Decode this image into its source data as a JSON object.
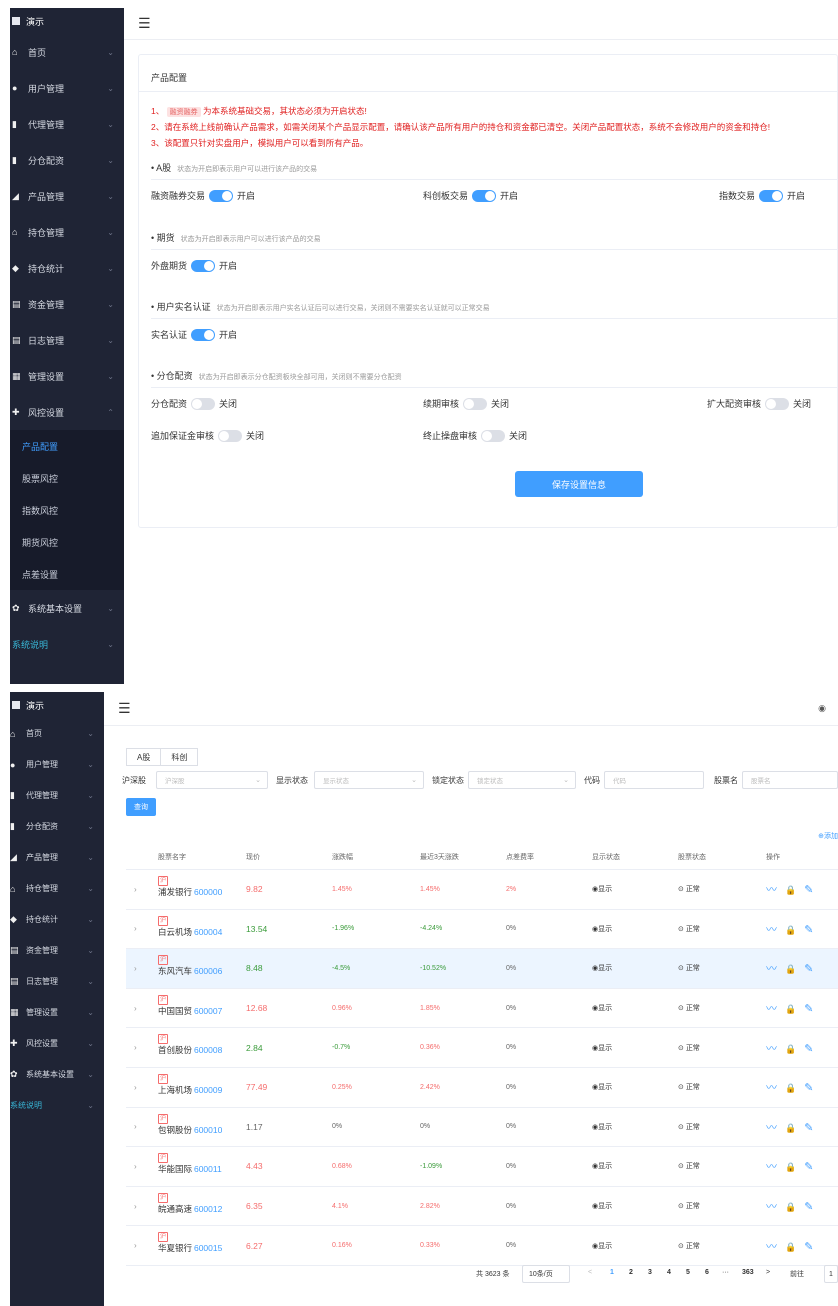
{
  "screen1": {
    "logo": "演示",
    "nav": [
      {
        "icon": "home-icon",
        "glyph": "⌂",
        "label": "首页",
        "chev": false
      },
      {
        "icon": "user-icon",
        "glyph": "●",
        "label": "用户管理",
        "chev": true
      },
      {
        "icon": "agent-icon",
        "glyph": "▮",
        "label": "代理管理",
        "chev": true
      },
      {
        "icon": "allocation-icon",
        "glyph": "▮",
        "label": "分仓配资",
        "chev": true
      },
      {
        "icon": "product-icon",
        "glyph": "◢",
        "label": "产品管理",
        "chev": true
      },
      {
        "icon": "position-icon",
        "glyph": "⌂",
        "label": "持仓管理",
        "chev": true
      },
      {
        "icon": "stats-icon",
        "glyph": "◆",
        "label": "持仓统计",
        "chev": true
      },
      {
        "icon": "fund-icon",
        "glyph": "▤",
        "label": "资金管理",
        "chev": true
      },
      {
        "icon": "log-icon",
        "glyph": "▤",
        "label": "日志管理",
        "chev": true
      },
      {
        "icon": "admin-icon",
        "glyph": "▦",
        "label": "管理设置",
        "chev": true
      },
      {
        "icon": "risk-icon",
        "glyph": "✚",
        "label": "风控设置",
        "chev": true,
        "open": true
      }
    ],
    "sub_nav": [
      {
        "label": "产品配置",
        "active": true
      },
      {
        "label": "股票风控",
        "active": false
      },
      {
        "label": "指数风控",
        "active": false
      },
      {
        "label": "期货风控",
        "active": false
      },
      {
        "label": "点差设置",
        "active": false
      }
    ],
    "nav_after": [
      {
        "icon": "system-icon",
        "glyph": "✿",
        "label": "系统基本设置",
        "chev": true
      },
      {
        "icon": "",
        "glyph": "",
        "label": "系统说明",
        "chev": true,
        "cyan": true
      }
    ],
    "card_title": "产品配置",
    "notices": {
      "n1_prefix": "1、",
      "n1_tag": "融资融券",
      "n1_text": "为本系统基础交易，其状态必须为开启状态!",
      "n2": "2、请在系统上线前确认产品需求，如需关闭某个产品显示配置，请确认该产品所有用户的持仓和资金都已清空。关闭产品配置状态，系统不会修改用户的资金和持仓!",
      "n3": "3、该配置只针对实盘用户，模拟用户可以看到所有产品。"
    },
    "sections": {
      "a_stock": {
        "title": "• A股",
        "desc": "状态为开启即表示用户可以进行该产品的交易"
      },
      "futures": {
        "title": "• 期货",
        "desc": "状态为开启即表示用户可以进行该产品的交易"
      },
      "realname": {
        "title": "• 用户实名认证",
        "desc": "状态为开启即表示用户实名认证后可以进行交易，关闭则不需要实名认证就可以正常交易"
      },
      "allocation": {
        "title": "• 分仓配资",
        "desc": "状态为开启即表示分仓配资板块全部可用，关闭则不需要分仓配资"
      }
    },
    "switches": {
      "margin": {
        "label": "融资融券交易",
        "state": "开启"
      },
      "star": {
        "label": "科创板交易",
        "state": "开启"
      },
      "index": {
        "label": "指数交易",
        "state": "开启"
      },
      "foreign_futures": {
        "label": "外盘期货",
        "state": "开启"
      },
      "realname": {
        "label": "实名认证",
        "state": "开启"
      },
      "alloc": {
        "label": "分仓配资",
        "state": "关闭"
      },
      "renew": {
        "label": "续期审核",
        "state": "关闭"
      },
      "expand": {
        "label": "扩大配资审核",
        "state": "关闭"
      },
      "margin_add": {
        "label": "追加保证金审核",
        "state": "关闭"
      },
      "stop": {
        "label": "终止操盘审核",
        "state": "关闭"
      }
    },
    "save_label": "保存设置信息"
  },
  "screen2": {
    "logo": "演示",
    "nav": [
      {
        "icon": "home-icon",
        "glyph": "⌂",
        "label": "首页"
      },
      {
        "icon": "user-icon",
        "glyph": "●",
        "label": "用户管理"
      },
      {
        "icon": "agent-icon",
        "glyph": "▮",
        "label": "代理管理"
      },
      {
        "icon": "allocation-icon",
        "glyph": "▮",
        "label": "分仓配资"
      },
      {
        "icon": "product-icon",
        "glyph": "◢",
        "label": "产品管理"
      },
      {
        "icon": "position-icon",
        "glyph": "⌂",
        "label": "持仓管理"
      },
      {
        "icon": "stats-icon",
        "glyph": "◆",
        "label": "持仓统计"
      },
      {
        "icon": "fund-icon",
        "glyph": "▤",
        "label": "资金管理"
      },
      {
        "icon": "log-icon",
        "glyph": "▤",
        "label": "日志管理"
      },
      {
        "icon": "admin-icon",
        "glyph": "▦",
        "label": "管理设置"
      },
      {
        "icon": "risk-icon",
        "glyph": "✚",
        "label": "风控设置"
      },
      {
        "icon": "system-icon",
        "glyph": "✿",
        "label": "系统基本设置"
      },
      {
        "icon": "",
        "glyph": "",
        "label": "系统说明",
        "cyan": true
      }
    ],
    "tabs": [
      "A股",
      "科创"
    ],
    "filters": {
      "market_label": "沪深股",
      "market_ph": "沪深股",
      "show_label": "显示状态",
      "show_ph": "显示状态",
      "lock_label": "锁定状态",
      "lock_ph": "锁定状态",
      "code_label": "代码",
      "code_ph": "代码",
      "name_label": "股票名",
      "name_ph": "股票名"
    },
    "query_label": "查询",
    "add_label": "⊕添加",
    "columns": [
      "股票名字",
      "现价",
      "涨跌幅",
      "最近3天涨跌",
      "点差费率",
      "显示状态",
      "股票状态",
      "操作"
    ],
    "rows": [
      {
        "name": "浦发银行",
        "code": "600000",
        "price": "9.82",
        "chg": "1.45%",
        "chg3": "1.45%",
        "spread": "2%",
        "show": "显示",
        "status": "正常",
        "pc": "red",
        "cc": "red",
        "c3": "red",
        "sc": "red"
      },
      {
        "name": "白云机场",
        "code": "600004",
        "price": "13.54",
        "chg": "-1.96%",
        "chg3": "-4.24%",
        "spread": "0%",
        "show": "显示",
        "status": "正常",
        "pc": "green",
        "cc": "green",
        "c3": "green",
        "sc": "gray"
      },
      {
        "name": "东风汽车",
        "code": "600006",
        "price": "8.48",
        "chg": "-4.5%",
        "chg3": "-10.52%",
        "spread": "0%",
        "show": "显示",
        "status": "正常",
        "pc": "green",
        "cc": "green",
        "c3": "green",
        "sc": "gray",
        "hl": true
      },
      {
        "name": "中国国贸",
        "code": "600007",
        "price": "12.68",
        "chg": "0.96%",
        "chg3": "1.85%",
        "spread": "0%",
        "show": "显示",
        "status": "正常",
        "pc": "red",
        "cc": "red",
        "c3": "red",
        "sc": "gray"
      },
      {
        "name": "首创股份",
        "code": "600008",
        "price": "2.84",
        "chg": "-0.7%",
        "chg3": "0.36%",
        "spread": "0%",
        "show": "显示",
        "status": "正常",
        "pc": "green",
        "cc": "green",
        "c3": "red",
        "sc": "gray"
      },
      {
        "name": "上海机场",
        "code": "600009",
        "price": "77.49",
        "chg": "0.25%",
        "chg3": "2.42%",
        "spread": "0%",
        "show": "显示",
        "status": "正常",
        "pc": "red",
        "cc": "red",
        "c3": "red",
        "sc": "gray"
      },
      {
        "name": "包钢股份",
        "code": "600010",
        "price": "1.17",
        "chg": "0%",
        "chg3": "0%",
        "spread": "0%",
        "show": "显示",
        "status": "正常",
        "pc": "gray",
        "cc": "gray",
        "c3": "gray",
        "sc": "gray"
      },
      {
        "name": "华能国际",
        "code": "600011",
        "price": "4.43",
        "chg": "0.68%",
        "chg3": "-1.09%",
        "spread": "0%",
        "show": "显示",
        "status": "正常",
        "pc": "red",
        "cc": "red",
        "c3": "green",
        "sc": "gray"
      },
      {
        "name": "皖通高速",
        "code": "600012",
        "price": "6.35",
        "chg": "4.1%",
        "chg3": "2.82%",
        "spread": "0%",
        "show": "显示",
        "status": "正常",
        "pc": "red",
        "cc": "red",
        "c3": "red",
        "sc": "gray"
      },
      {
        "name": "华夏银行",
        "code": "600015",
        "price": "6.27",
        "chg": "0.16%",
        "chg3": "0.33%",
        "spread": "0%",
        "show": "显示",
        "status": "正常",
        "pc": "red",
        "cc": "red",
        "c3": "red",
        "sc": "gray"
      }
    ],
    "pager": {
      "total": "共 3623 条",
      "page_size": "10条/页",
      "pages": [
        "1",
        "2",
        "3",
        "4",
        "5",
        "6"
      ],
      "ellipsis": "···",
      "last": "363",
      "prev": "<",
      "next": ">",
      "goto_label": "前往",
      "goto_value": "1"
    }
  }
}
